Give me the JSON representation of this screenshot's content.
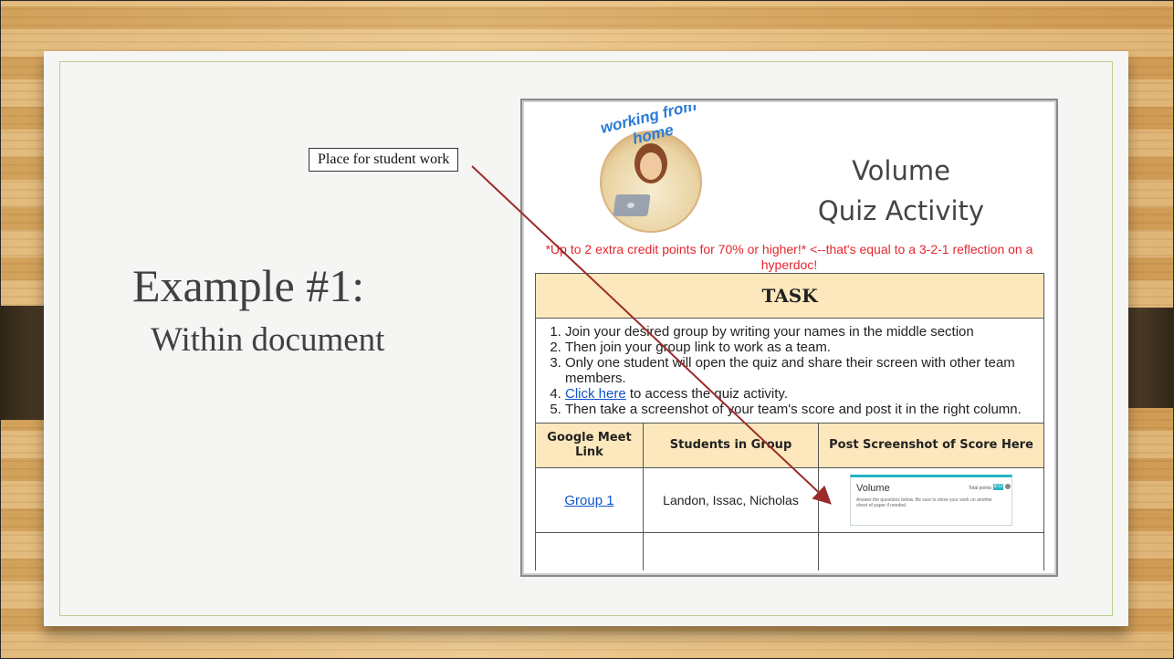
{
  "slide": {
    "title": "Example #1:",
    "subtitle": "Within document",
    "callout": "Place for student work"
  },
  "doc": {
    "avatar_text": "working from home",
    "title_line1": "Volume",
    "title_line2": "Quiz Activity",
    "extra_credit": "*Up to 2 extra credit points for 70% or higher!* <--that's equal to a 3-2-1 reflection on a hyperdoc!",
    "task_header": "TASK",
    "steps": [
      "Join your desired group by writing your names in the middle section",
      "Then join your group link to work as a team.",
      "Only one student will open the quiz and share their screen with other team members."
    ],
    "step4_link": "Click here",
    "step4_rest": " to access the quiz activity.",
    "step5": "Then take a screenshot of your team's score and post it in the right column.",
    "columns": [
      "Google Meet Link",
      "Students in Group",
      "Post Screenshot of Score Here"
    ],
    "rows": [
      {
        "link": "Group 1",
        "students": "Landon, Issac, Nicholas",
        "screenshot": {
          "title": "Volume",
          "points_label": "Total points",
          "points_value": "8/10",
          "description": "Answer the questions below. Be sure to show your work on another sheet of paper if needed."
        }
      }
    ]
  }
}
